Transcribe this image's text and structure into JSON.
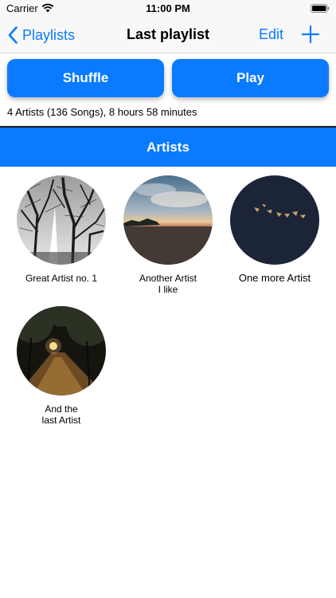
{
  "status_bar": {
    "carrier": "Carrier",
    "time": "11:00 PM",
    "icons": [
      "wifi-icon",
      "battery-icon"
    ]
  },
  "nav": {
    "back_label": "Playlists",
    "title": "Last playlist",
    "edit_label": "Edit",
    "add_icon": "plus-icon"
  },
  "actions": {
    "shuffle_label": "Shuffle",
    "play_label": "Play"
  },
  "summary": "4 Artists (136 Songs), 8 hours 58 minutes",
  "section_title": "Artists",
  "artists": [
    {
      "name": "Great Artist no. 1",
      "image": "bare-trees-silhouette"
    },
    {
      "name": "Another Artist\nI like",
      "image": "beach-sunset"
    },
    {
      "name": "One more Artist",
      "image": "night-sky-birds"
    },
    {
      "name": "And the\nlast Artist",
      "image": "park-path-at-night"
    }
  ],
  "colors": {
    "accent": "#0a7aff",
    "nav_background": "#f8f8f8",
    "button_text": "#ffffff"
  }
}
